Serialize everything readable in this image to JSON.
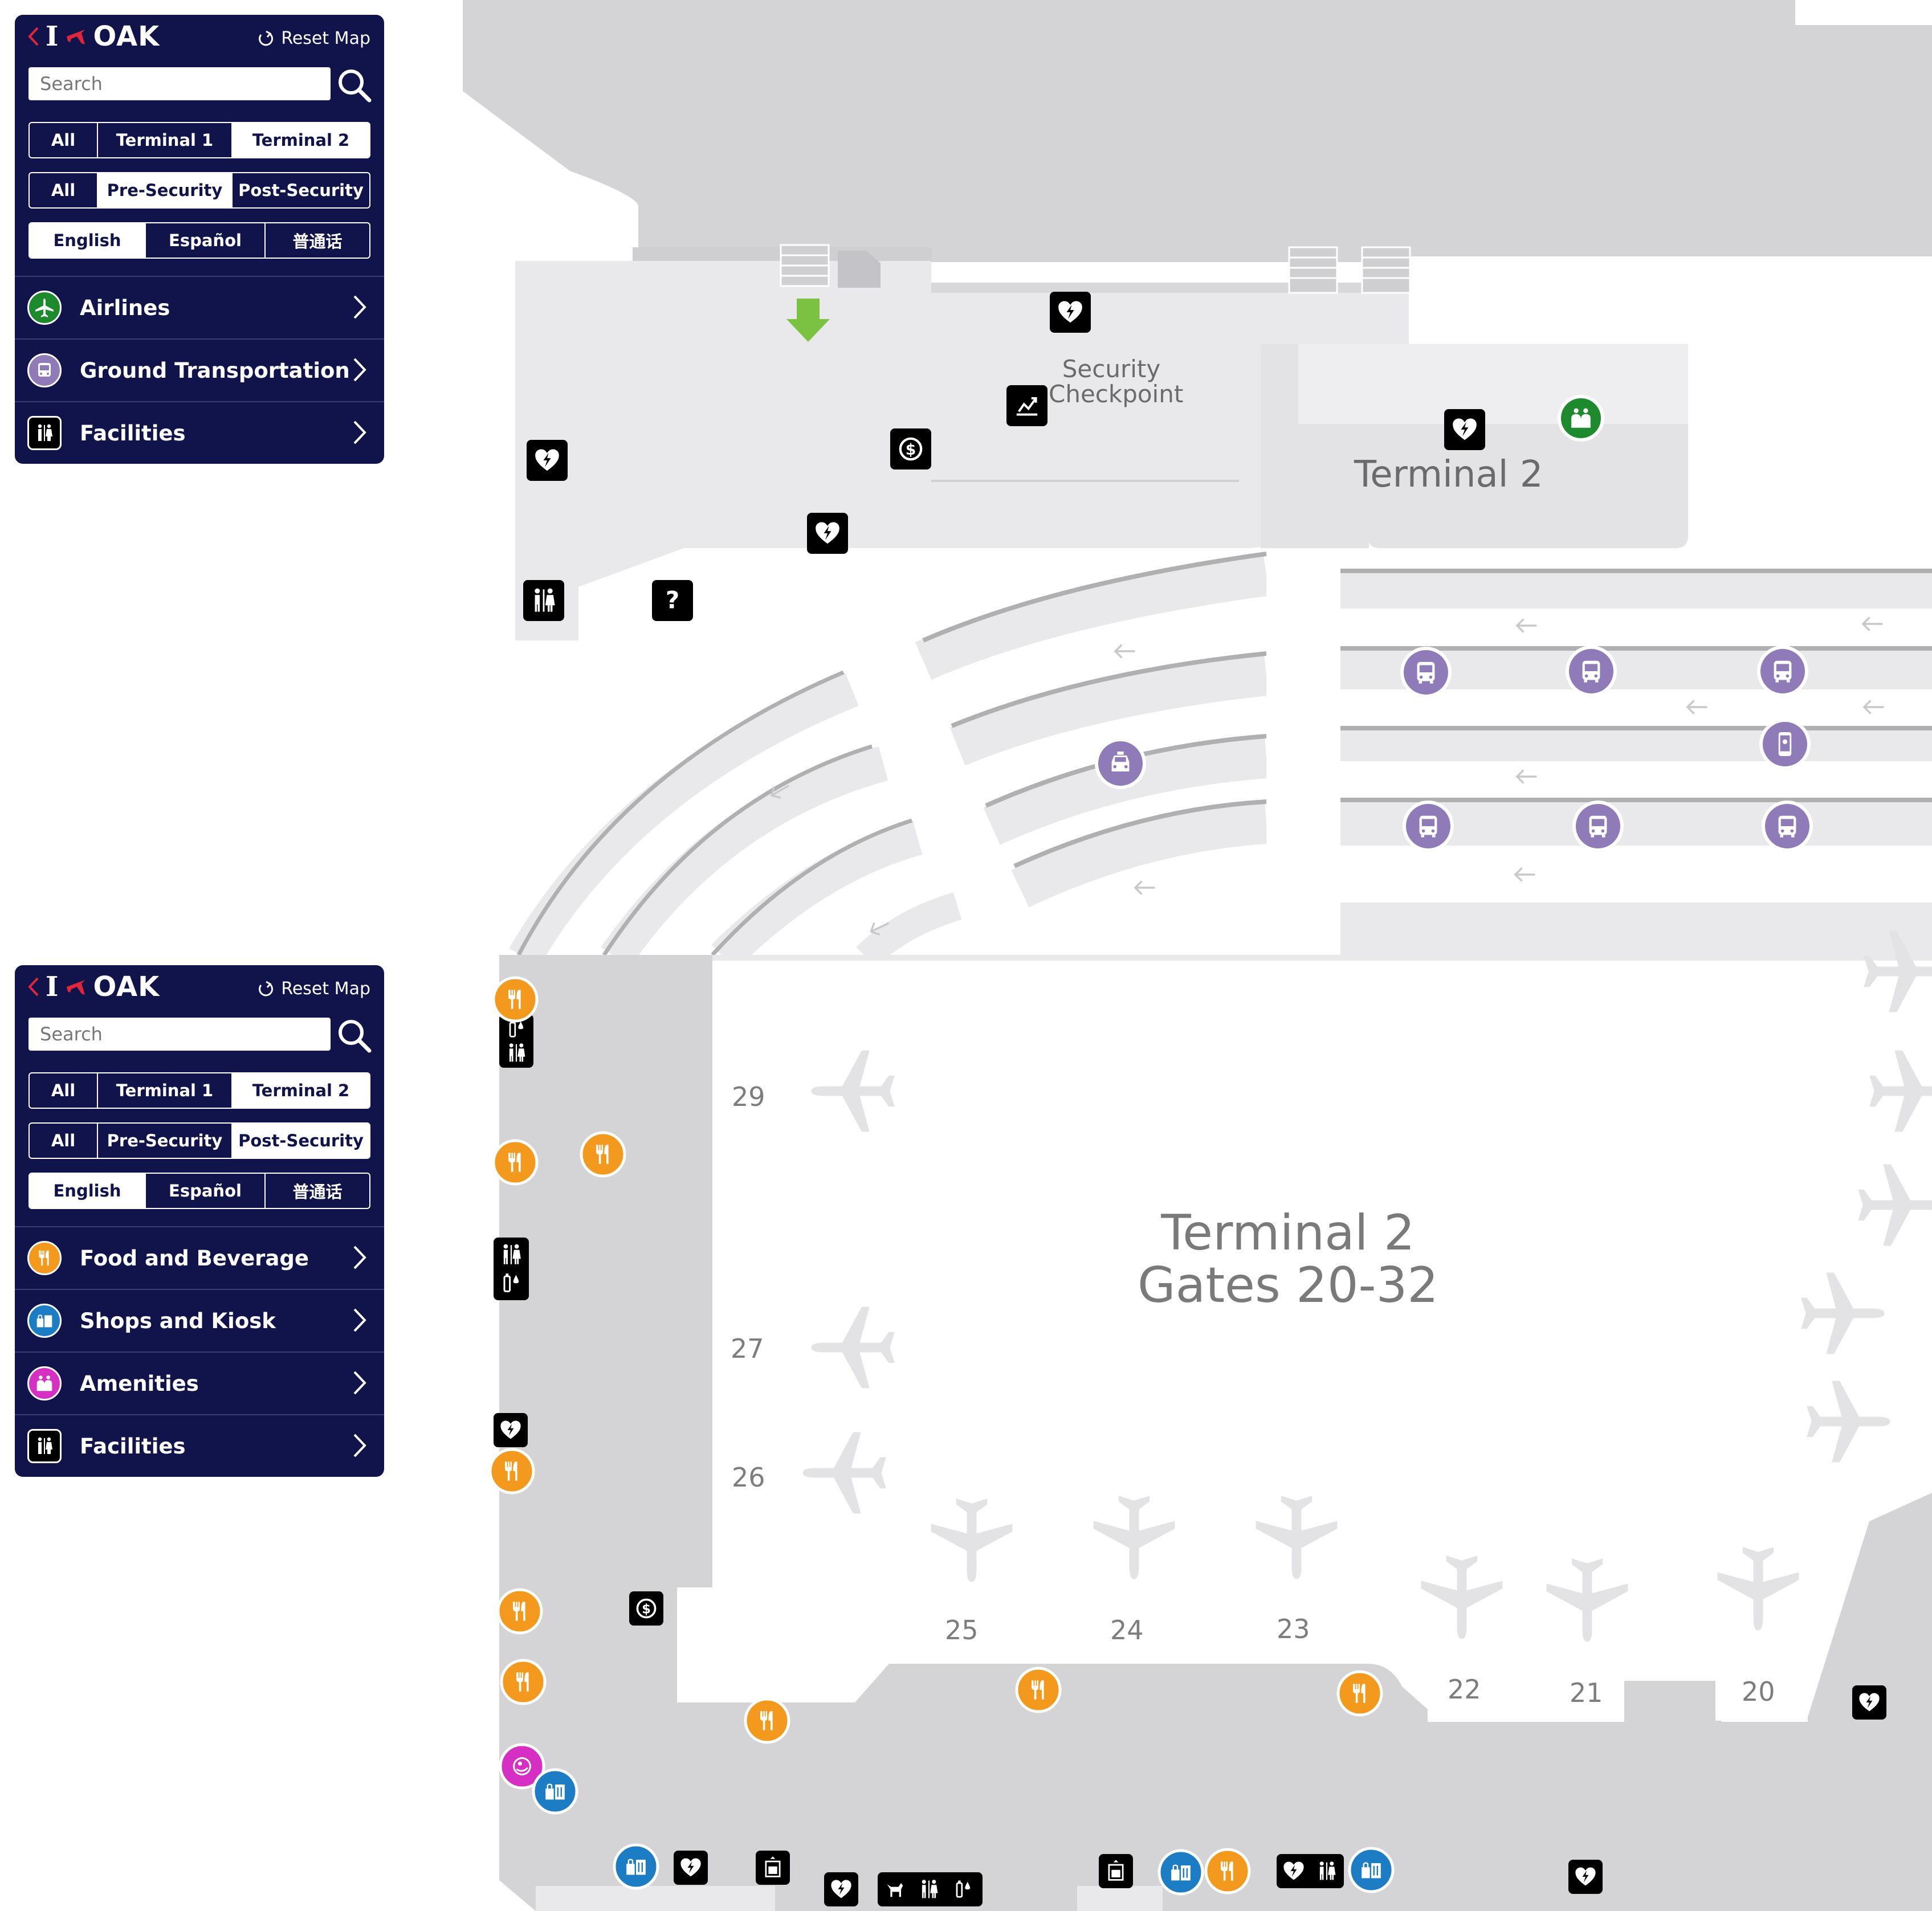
{
  "panels": [
    {
      "brand": "OAK",
      "reset_label": "Reset Map",
      "search_placeholder": "Search",
      "terminal_filter": [
        "All",
        "Terminal 1",
        "Terminal 2"
      ],
      "terminal_selected": "Terminal 2",
      "security_filter": [
        "All",
        "Pre-Security",
        "Post-Security"
      ],
      "security_selected": "Pre-Security",
      "language_filter": [
        "English",
        "Español",
        "普通话"
      ],
      "language_selected": "English",
      "categories": [
        {
          "label": "Airlines",
          "icon": "airplane-icon",
          "color": "#1e8a2e"
        },
        {
          "label": "Ground Transportation",
          "icon": "bus-icon",
          "color": "#8e7bb8"
        },
        {
          "label": "Facilities",
          "icon": "restroom-icon",
          "color": "#000000"
        }
      ]
    },
    {
      "brand": "OAK",
      "reset_label": "Reset Map",
      "search_placeholder": "Search",
      "terminal_filter": [
        "All",
        "Terminal 1",
        "Terminal 2"
      ],
      "terminal_selected": "Terminal 2",
      "security_filter": [
        "All",
        "Pre-Security",
        "Post-Security"
      ],
      "security_selected": "Post-Security",
      "language_filter": [
        "English",
        "Español",
        "普通话"
      ],
      "language_selected": "English",
      "categories": [
        {
          "label": "Food and Beverage",
          "icon": "fork-knife-icon",
          "color": "#f39a1e"
        },
        {
          "label": "Shops and Kiosk",
          "icon": "shopping-bag-icon",
          "color": "#1d7dc4"
        },
        {
          "label": "Amenities",
          "icon": "amenities-icon",
          "color": "#d62fc4"
        },
        {
          "label": "Facilities",
          "icon": "restroom-icon",
          "color": "#000000"
        }
      ]
    }
  ],
  "map": {
    "security_label_line1": "Security",
    "security_label_line2": "Checkpoint",
    "terminal_label": "Terminal 2",
    "concourse_line1": "Terminal 2",
    "concourse_line2": "Gates 20-32",
    "gates": [
      "29",
      "27",
      "26",
      "25",
      "24",
      "23",
      "22",
      "21",
      "20"
    ]
  },
  "colors": {
    "panel_bg": "#11134b",
    "brand_red": "#e1253a",
    "food": "#f39a1e",
    "shops": "#1d7dc4",
    "amenities": "#d62fc4",
    "transport": "#8e7bb8",
    "airlines": "#1e8a2e"
  }
}
